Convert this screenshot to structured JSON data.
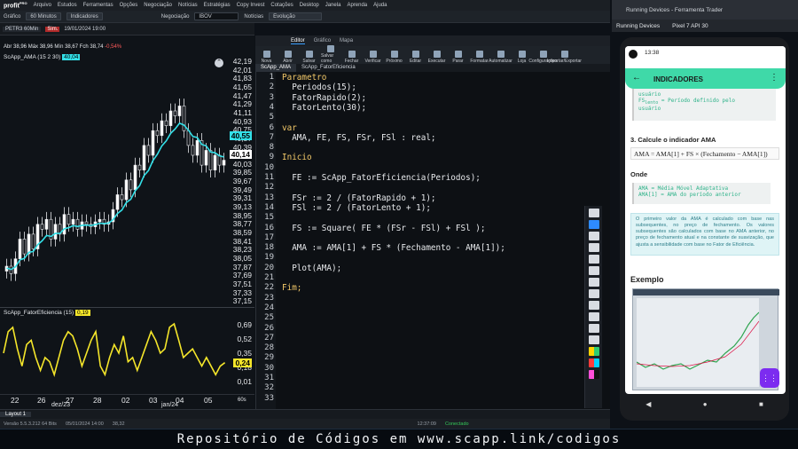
{
  "menu": {
    "logo": "profit",
    "logo_sub": "PRO",
    "items": [
      "Arquivo",
      "Estudos",
      "Ferramentas",
      "Opções",
      "Negociação",
      "Notícias",
      "Estratégias",
      "Copy Invest",
      "Cotações",
      "Desktop",
      "Janela",
      "Aprenda",
      "Ajuda"
    ]
  },
  "toolbar": {
    "grafico": "Gráfico",
    "interval": "60 Minutos",
    "indicadores": "Indicadores",
    "negociacao": "Negociação",
    "symbol": "IBOV",
    "noticias": "Notícias",
    "evolucao": "Evolução"
  },
  "chart": {
    "symbol": "PETR3 60Min",
    "sim": "Sim.",
    "date": "19/01/2024 19:00",
    "abr": "Abr 38,96",
    "max": "Máx 38,96",
    "min": "Mín 38,67",
    "fch": "Fch 38,74",
    "var": "-0,54%",
    "header": "ScApp_AMA (15 2 30)",
    "header_val": "40,04",
    "y_ticks": [
      "42,19",
      "42,01",
      "41,83",
      "41,65",
      "41,47",
      "41,29",
      "41,11",
      "40,93",
      "40,75",
      "40,57",
      "40,39",
      "40,21",
      "40,03",
      "39,85",
      "39,67",
      "39,49",
      "39,31",
      "39,13",
      "38,95",
      "38,77",
      "38,59",
      "38,41",
      "38,23",
      "38,05",
      "37,87",
      "37,69",
      "37,51",
      "37,33",
      "37,15"
    ],
    "ama_label": "40,55",
    "price_label": "40,14",
    "ama_color": "#33e0e8",
    "sub_header": "ScApp_FatorEficiencia (15)",
    "sub_val": "0,19",
    "sub_ticks": [
      "0,69",
      "0,52",
      "0,35",
      "0,18",
      "0,01"
    ],
    "sub_label": "0,24",
    "x_ticks": [
      "22",
      "26",
      "27",
      "28",
      "02",
      "03",
      "04",
      "05"
    ],
    "x_month": [
      "dez/23",
      "jan/24"
    ],
    "x_unit": "60s"
  },
  "editor": {
    "top_tabs": [
      "Editor",
      "Gráfico",
      "Mapa"
    ],
    "tools": [
      "Nova",
      "Abrir",
      "Salvar",
      "Salvar como",
      "Fechar",
      "Verificar",
      "Próximo",
      "Editar",
      "Executar",
      "Parar",
      "Formatar",
      "Automatizar",
      "Loja",
      "Configurações",
      "Importar/Exportar"
    ],
    "file_tabs": [
      "ScApp_AMA",
      "ScApp_FatorEficiencia"
    ],
    "line_numbers": [
      "1",
      "2",
      "3",
      "4",
      "5",
      "6",
      "7",
      "8",
      "9",
      "10",
      "11",
      "12",
      "13",
      "14",
      "15",
      "16",
      "17",
      "18",
      "19",
      "20",
      "21",
      "22",
      "23",
      "24",
      "25",
      "26",
      "27",
      "28",
      "29",
      "30",
      "31",
      "32",
      "33"
    ],
    "code": [
      "Parametro",
      "  Periodos(15);",
      "  FatorRapido(2);",
      "  FatorLento(30);",
      "",
      "var",
      "  AMA, FE, FS, FSr, FSl : real;",
      "",
      "Inicio",
      "",
      "  FE := ScApp_FatorEficiencia(Periodos);",
      "",
      "  FSr := 2 / (FatorRapido + 1);",
      "  FSl := 2 / (FatorLento + 1);",
      "",
      "  FS := Square( FE * (FSr - FSl) + FSl );",
      "",
      "  AMA := AMA[1] + FS * (Fechamento - AMA[1]);",
      "",
      "  Plot(AMA);",
      "",
      "Fim;"
    ]
  },
  "layout": {
    "tab": "Layout 1"
  },
  "status": {
    "version": "Versão 5.5.3.212 64 Bits",
    "date": "05/01/2024 14:00",
    "price": "38,32",
    "time": "12:37:09",
    "conn": "Conectado"
  },
  "banner": "Repositório de Códigos em www.scapp.link/codigos",
  "emulator": {
    "title": "Running Devices - Ferramenta Trader",
    "tab1": "Running Devices",
    "tab2": "Pixel 7 API 30",
    "time": "13:38",
    "app_title": "INDICADORES",
    "card_top": [
      "usuário",
      "FS",
      "lento",
      " = Período definido pelo",
      "usuário"
    ],
    "step3": "3. Calcule o indicador AMA",
    "formula": "AMA = AMA[1] + FS × (Fechamento − AMA[1])",
    "onde": "Onde",
    "onde_lines": [
      "AMA = Média Móvel Adaptativa",
      "AMA[1] = AMA do período anterior"
    ],
    "info": "O primeiro valor da AMA é calculado com base nas subsequentes, no preço de fechamento. Os valores subsequentes são calculados com base no AMA anterior, no preço de fechamento atual e na constante de suavização, que ajusta a sensibilidade com base no Fator de Eficiência.",
    "exemplo": "Exemplo"
  }
}
